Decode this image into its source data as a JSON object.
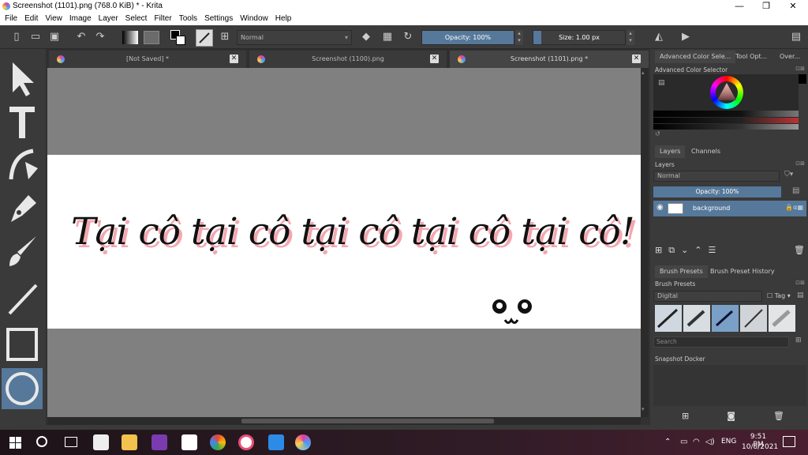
{
  "window": {
    "title": "Screenshot (1101).png (768.0 KiB)  * - Krita",
    "controls": {
      "minimize": "—",
      "maximize": "❐",
      "close": "✕"
    }
  },
  "menu": [
    "File",
    "Edit",
    "View",
    "Image",
    "Layer",
    "Select",
    "Filter",
    "Tools",
    "Settings",
    "Window",
    "Help"
  ],
  "toolbar": {
    "blend_mode": "Normal",
    "opacity": "Opacity: 100%",
    "size": "Size: 1.00 px"
  },
  "tabs": [
    {
      "label": "[Not Saved]  *"
    },
    {
      "label": "Screenshot (1100).png"
    },
    {
      "label": "Screenshot (1101).png *"
    }
  ],
  "canvas": {
    "text": "Tại cô tại cô tại cô tại cô tại cô!",
    "text_color": "#111111",
    "shadow_color": "#f4a7b0"
  },
  "right_panel": {
    "top_tabs": [
      "Advanced Color Sele...",
      "Tool Opt...",
      "Over..."
    ],
    "color_selector_title": "Advanced Color Selector",
    "layer_tabs": [
      "Layers",
      "Channels"
    ],
    "layers_title": "Layers",
    "layers_blend": "Normal",
    "layers_opacity": "Opacity:  100%",
    "layer_name": "background",
    "brush_tabs": [
      "Brush Presets",
      "Brush Preset History"
    ],
    "brush_title": "Brush Presets",
    "brush_filter": "Digital",
    "brush_tag": "Tag",
    "search_placeholder": "Search",
    "snapshot_title": "Snapshot Docker"
  },
  "taskbar": {
    "lang": "ENG",
    "time": "9:51 PM",
    "date": "10/8/2021"
  }
}
